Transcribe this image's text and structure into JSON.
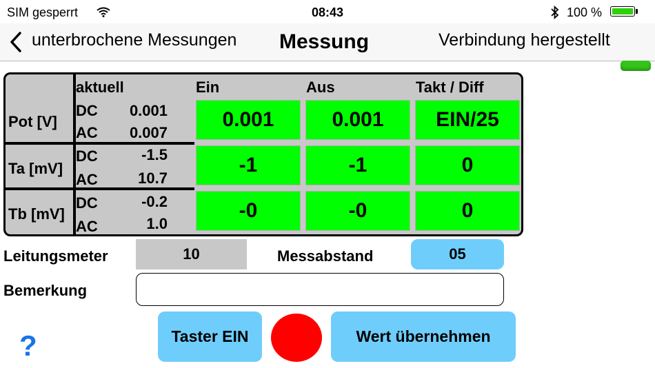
{
  "status_bar": {
    "carrier": "SIM gesperrt",
    "time": "08:43",
    "battery_percent": "100 %",
    "battery_fill": 1.0
  },
  "nav": {
    "back_label": "unterbrochene Messungen",
    "title": "Messung",
    "connection_status": "Verbindung hergestellt"
  },
  "table": {
    "headers": {
      "current": "aktuell",
      "on": "Ein",
      "off": "Aus",
      "cycle_diff": "Takt / Diff"
    },
    "rows": [
      {
        "label": "Pot [V]",
        "dc_label": "DC",
        "dc_value": "0.001",
        "ac_label": "AC",
        "ac_value": "0.007",
        "on": "0.001",
        "off": "0.001",
        "cycle": "EIN/25"
      },
      {
        "label": "Ta [mV]",
        "dc_label": "DC",
        "dc_value": "-1.5",
        "ac_label": "AC",
        "ac_value": "10.7",
        "on": "-1",
        "off": "-1",
        "cycle": "0"
      },
      {
        "label": "Tb [mV]",
        "dc_label": "DC",
        "dc_value": "-0.2",
        "ac_label": "AC",
        "ac_value": "1.0",
        "on": "-0",
        "off": "-0",
        "cycle": "0"
      }
    ]
  },
  "form": {
    "line_meter_label": "Leitungsmeter",
    "line_meter_value": "10",
    "interval_label": "Messabstand",
    "interval_value": "05",
    "remark_label": "Bemerkung",
    "remark_value": ""
  },
  "actions": {
    "help": "?",
    "taster_label": "Taster EIN",
    "accept_label": "Wert übernehmen"
  },
  "colors": {
    "cell_green": "#00ff00",
    "button_blue": "#6fcdfb",
    "indicator_red": "#ff0000",
    "help_blue": "#1a73e8"
  }
}
